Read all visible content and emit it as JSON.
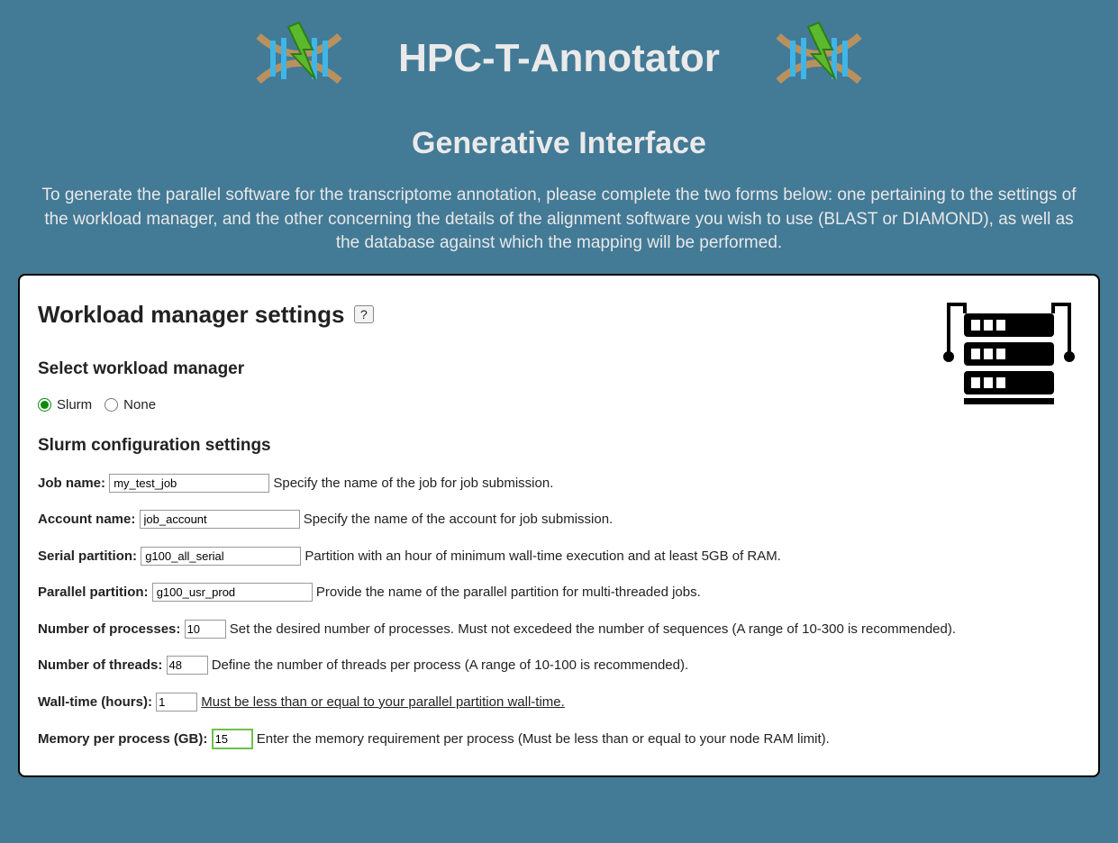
{
  "header": {
    "title": "HPC-T-Annotator",
    "subtitle": "Generative Interface",
    "intro": "To generate the parallel software for the transcriptome annotation, please complete the two forms below: one pertaining to the settings of the workload manager, and the other concerning the details of the alignment software you wish to use (BLAST or DIAMOND), as well as the database against which the mapping will be performed."
  },
  "card": {
    "title": "Workload manager settings",
    "help": "?",
    "select_label": "Select workload manager",
    "radios": {
      "slurm": "Slurm",
      "none": "None"
    },
    "config_label": "Slurm configuration settings",
    "fields": {
      "job_name": {
        "label": "Job name:",
        "value": "my_test_job",
        "hint": "Specify the name of the job for job submission."
      },
      "account": {
        "label": "Account name:",
        "value": "job_account",
        "hint": "Specify the name of the account for job submission."
      },
      "serial": {
        "label": "Serial partition:",
        "value": "g100_all_serial",
        "hint": "Partition with an hour of minimum wall-time execution and at least 5GB of RAM."
      },
      "parallel": {
        "label": "Parallel partition:",
        "value": "g100_usr_prod",
        "hint": "Provide the name of the parallel partition for multi-threaded jobs."
      },
      "processes": {
        "label": "Number of processes:",
        "value": "10",
        "hint": "Set the desired number of processes. Must not excedeed the number of sequences (A range of 10-300 is recommended)."
      },
      "threads": {
        "label": "Number of threads:",
        "value": "48",
        "hint": "Define the number of threads per process (A range of 10-100 is recommended)."
      },
      "walltime": {
        "label": "Wall-time (hours):",
        "value": "1",
        "hint": "Must be less than or equal to your parallel partition wall-time."
      },
      "memory": {
        "label": "Memory per process (GB):",
        "value": "15",
        "hint": "Enter the memory requirement per process (Must be less than or equal to your node RAM limit)."
      }
    }
  }
}
